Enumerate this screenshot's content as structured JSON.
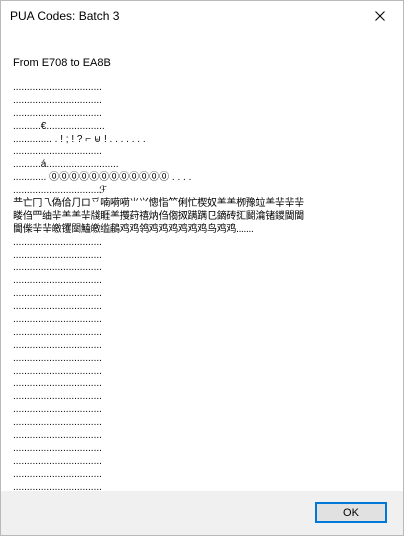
{
  "window": {
    "title": "PUA Codes: Batch 3",
    "close_icon": "close-icon"
  },
  "content": {
    "header": "From E708 to EA8B",
    "rows": [
      "................................",
      "................................",
      "................................",
      "..........€.....................",
      ".............. . ! ; ! ? ⌐ ⊌ ! . . . . . . .",
      "................................",
      "..........á..........................",
      "............ ⓪⓪⓪⓪⓪⓪⓪⓪⓪⓪⓪⓪ . . . .",
      "...............................ℱ",
      "龷亡冂乁偽佮⺆ロ乊喃嗬嗬⺌⺍憁恉⺮俐忙楔奴⺷⺷栁豫竝⺷⺸⺸⺸",
      "䁖㑇⺲䌷⺸⺷⺷⺸牋睚⺷㩳荮禧㶧㑇㑳㧐蹒蹒⺋鏑砖㧟鬭㵸锗鑁閫閫",
      "閫偨⺸⺸皦䦆䦟鰪皦䍀鵏鸡鸡鸰鸡鸡鸡鸡鸡鸡鸟鸡鸡.......",
      "................................",
      "................................",
      "................................",
      "................................",
      "................................",
      "................................",
      "................................",
      "................................",
      "................................",
      "................................",
      "................................",
      "................................",
      "................................",
      "................................",
      "................................",
      "................................",
      "................................",
      "................................",
      "................................",
      "................................"
    ]
  },
  "footer": {
    "ok_label": "OK"
  },
  "colors": {
    "accent_border": "#0078d7",
    "footer_bg": "#f0f0f0",
    "button_bg": "#e1e1e1"
  }
}
